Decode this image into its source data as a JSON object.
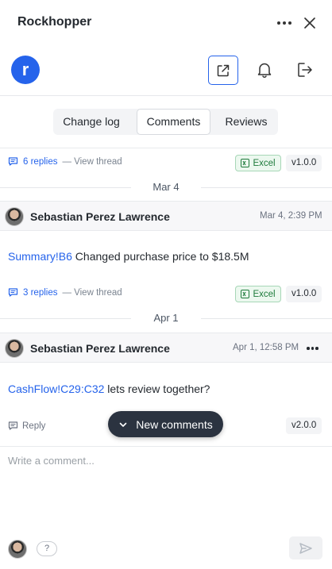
{
  "app": {
    "title": "Rockhopper",
    "logo_letter": "r"
  },
  "tabs": [
    {
      "label": "Change log",
      "active": false
    },
    {
      "label": "Comments",
      "active": true
    },
    {
      "label": "Reviews",
      "active": false
    }
  ],
  "thread0": {
    "replies": "6 replies",
    "view": "— View thread",
    "app_badge": "Excel",
    "version": "v1.0.0"
  },
  "groups": [
    {
      "date": "Mar 4",
      "author": "Sebastian Perez Lawrence",
      "timestamp": "Mar 4, 2:39 PM",
      "cell_ref": "Summary!B6",
      "text": " Changed purchase price to $18.5M",
      "replies": "3 replies",
      "view": "— View thread",
      "app_badge": "Excel",
      "version": "v1.0.0"
    },
    {
      "date": "Apr 1",
      "author": "Sebastian Perez Lawrence",
      "timestamp": "Apr 1, 12:58 PM",
      "cell_ref": "CashFlow!C29:C32",
      "text": " lets review together?",
      "reply": "Reply",
      "version": "v2.0.0"
    }
  ],
  "new_comments": {
    "label": "New comments"
  },
  "composer": {
    "placeholder": "Write a comment...",
    "value": "",
    "help": "?"
  },
  "colors": {
    "accent": "#2563eb",
    "excel_green": "#1e7b3c",
    "pill_bg": "#2b3340"
  }
}
